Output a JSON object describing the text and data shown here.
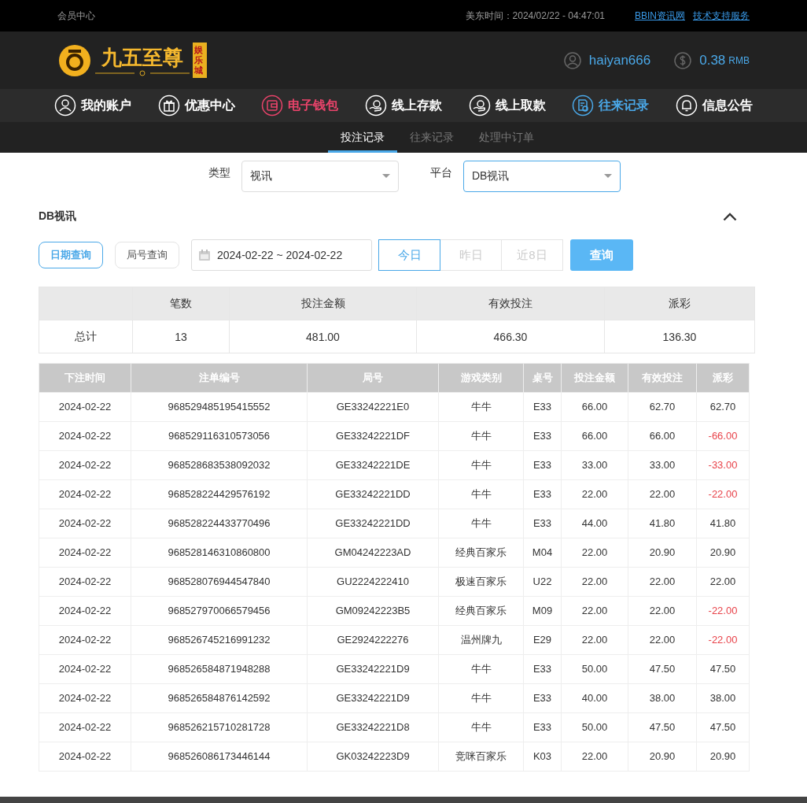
{
  "top_bar": {
    "title": "会员中心",
    "time": "美东时间：2024/02/22 - 04:47:01",
    "links": [
      "BBIN资讯网",
      "技术支持服务"
    ]
  },
  "header": {
    "logo_text": "九五至尊",
    "logo_badge": "娱乐城",
    "username": "haiyan666",
    "balance": "0.38",
    "currency": "RMB"
  },
  "nav": [
    {
      "label": "我的账户",
      "kind": "user",
      "color": "#ffffff"
    },
    {
      "label": "优惠中心",
      "kind": "gift",
      "color": "#ffffff"
    },
    {
      "label": "电子钱包",
      "kind": "wallet",
      "color": "#e8436a"
    },
    {
      "label": "线上存款",
      "kind": "deposit",
      "color": "#ffffff"
    },
    {
      "label": "线上取款",
      "kind": "withdraw",
      "color": "#ffffff"
    },
    {
      "label": "往来记录",
      "kind": "records",
      "color": "#4aa8e8"
    },
    {
      "label": "信息公告",
      "kind": "bell",
      "color": "#ffffff"
    }
  ],
  "sub_tabs": [
    {
      "label": "投注记录",
      "selected": true
    },
    {
      "label": "往来记录",
      "selected": false
    },
    {
      "label": "处理中订单",
      "selected": false
    }
  ],
  "filters": [
    {
      "label": "类型",
      "value": "视讯",
      "focused": false
    },
    {
      "label": "平台",
      "value": "DB视讯",
      "focused": true
    }
  ],
  "section_title": "DB视讯",
  "query_modes": [
    {
      "label": "日期查询",
      "selected": true
    },
    {
      "label": "局号查询",
      "selected": false
    }
  ],
  "date_range": "2024-02-22 ~ 2024-02-22",
  "quick_ranges": [
    {
      "label": "今日",
      "selected": true
    },
    {
      "label": "昨日",
      "selected": false
    },
    {
      "label": "近8日",
      "selected": false
    }
  ],
  "query_button": "查询",
  "summary": {
    "columns": [
      "笔数",
      "投注金额",
      "有效投注",
      "派彩"
    ],
    "row_label": "总计",
    "values": [
      "13",
      "481.00",
      "466.30",
      "136.30"
    ]
  },
  "table": {
    "columns": [
      "下注时间",
      "注单编号",
      "局号",
      "游戏类别",
      "桌号",
      "投注金额",
      "有效投注",
      "派彩"
    ],
    "rows": [
      {
        "cells": [
          "2024-02-22",
          "968529485195415552",
          "GE33242221E0",
          "牛牛",
          "E33",
          "66.00",
          "62.70",
          "62.70"
        ],
        "loss": false
      },
      {
        "cells": [
          "2024-02-22",
          "968529116310573056",
          "GE33242221DF",
          "牛牛",
          "E33",
          "66.00",
          "66.00",
          "-66.00"
        ],
        "loss": true
      },
      {
        "cells": [
          "2024-02-22",
          "968528683538092032",
          "GE33242221DE",
          "牛牛",
          "E33",
          "33.00",
          "33.00",
          "-33.00"
        ],
        "loss": true
      },
      {
        "cells": [
          "2024-02-22",
          "968528224429576192",
          "GE33242221DD",
          "牛牛",
          "E33",
          "22.00",
          "22.00",
          "-22.00"
        ],
        "loss": true
      },
      {
        "cells": [
          "2024-02-22",
          "968528224433770496",
          "GE33242221DD",
          "牛牛",
          "E33",
          "44.00",
          "41.80",
          "41.80"
        ],
        "loss": false
      },
      {
        "cells": [
          "2024-02-22",
          "968528146310860800",
          "GM04242223AD",
          "经典百家乐",
          "M04",
          "22.00",
          "20.90",
          "20.90"
        ],
        "loss": false
      },
      {
        "cells": [
          "2024-02-22",
          "968528076944547840",
          "GU2224222410",
          "极速百家乐",
          "U22",
          "22.00",
          "22.00",
          "22.00"
        ],
        "loss": false
      },
      {
        "cells": [
          "2024-02-22",
          "968527970066579456",
          "GM09242223B5",
          "经典百家乐",
          "M09",
          "22.00",
          "22.00",
          "-22.00"
        ],
        "loss": true
      },
      {
        "cells": [
          "2024-02-22",
          "968526745216991232",
          "GE2924222276",
          "温州牌九",
          "E29",
          "22.00",
          "22.00",
          "-22.00"
        ],
        "loss": true
      },
      {
        "cells": [
          "2024-02-22",
          "968526584871948288",
          "GE33242221D9",
          "牛牛",
          "E33",
          "50.00",
          "47.50",
          "47.50"
        ],
        "loss": false
      },
      {
        "cells": [
          "2024-02-22",
          "968526584876142592",
          "GE33242221D9",
          "牛牛",
          "E33",
          "40.00",
          "38.00",
          "38.00"
        ],
        "loss": false
      },
      {
        "cells": [
          "2024-02-22",
          "968526215710281728",
          "GE33242221D8",
          "牛牛",
          "E33",
          "50.00",
          "47.50",
          "47.50"
        ],
        "loss": false
      },
      {
        "cells": [
          "2024-02-22",
          "968526086173446144",
          "GK03242223D9",
          "竞咪百家乐",
          "K03",
          "22.00",
          "20.90",
          "20.90"
        ],
        "loss": false
      }
    ]
  }
}
